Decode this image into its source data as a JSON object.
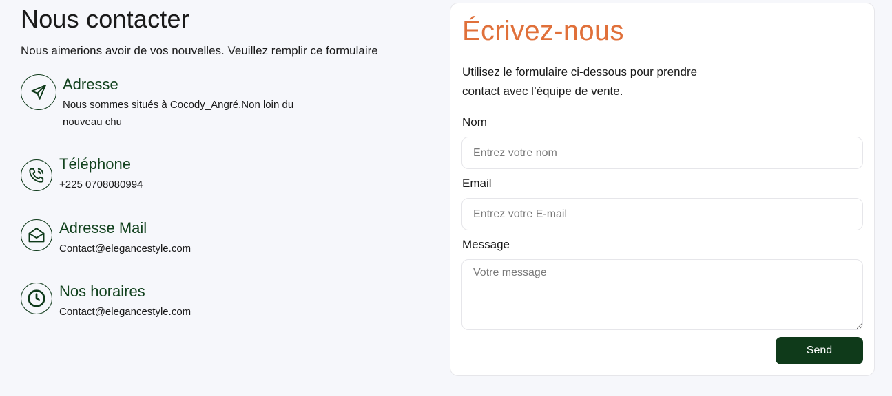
{
  "contact": {
    "title": "Nous contacter",
    "subtitle": "Nous aimerions avoir de vos nouvelles. Veuillez remplir ce formulaire",
    "items": [
      {
        "icon": "send-icon",
        "title": "Adresse",
        "value": "Nous sommes situés à Cocody_Angré,Non loin du nouveau chu"
      },
      {
        "icon": "phone-icon",
        "title": "Téléphone",
        "value": "+225 0708080994"
      },
      {
        "icon": "mail-icon",
        "title": "Adresse Mail",
        "value": "Contact@elegancestyle.com"
      },
      {
        "icon": "clock-icon",
        "title": "Nos horaires",
        "value": "Contact@elegancestyle.com"
      }
    ]
  },
  "form": {
    "title": "Écrivez-nous",
    "description": "Utilisez le formulaire ci-dessous pour prendre contact avec l’équipe de vente.",
    "name_label": "Nom",
    "name_placeholder": "Entrez votre nom",
    "name_value": "",
    "email_label": "Email",
    "email_placeholder": "Entrez votre E-mail",
    "email_value": "",
    "message_label": "Message",
    "message_placeholder": "Votre message",
    "message_value": "",
    "send_label": "Send"
  },
  "colors": {
    "accent_orange": "#e0703a",
    "brand_green": "#0f3a1a",
    "background": "#f6f7fb"
  }
}
